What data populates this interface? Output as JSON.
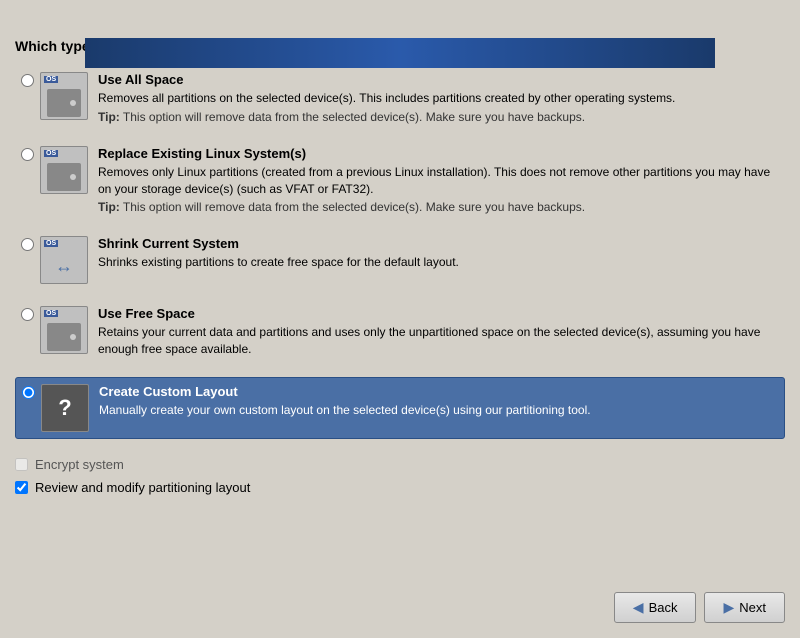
{
  "topBar": {},
  "pageTitle": "Which type of installation would you like?",
  "options": [
    {
      "id": "use-all-space",
      "title": "Use All Space",
      "desc": "Removes all partitions on the selected device(s).  This includes partitions created by other operating systems.",
      "tip": "Tip: This option will remove data from the selected device(s).  Make sure you have backups.",
      "selected": false,
      "iconType": "hdd-os"
    },
    {
      "id": "replace-existing",
      "title": "Replace Existing Linux System(s)",
      "desc": "Removes only Linux partitions (created from a previous Linux installation).  This does not remove other partitions you may have on your storage device(s) (such as VFAT or FAT32).",
      "tip": "Tip: This option will remove data from the selected device(s).  Make sure you have backups.",
      "selected": false,
      "iconType": "hdd-os"
    },
    {
      "id": "shrink-current",
      "title": "Shrink Current System",
      "desc": "Shrinks existing partitions to create free space for the default layout.",
      "tip": "",
      "selected": false,
      "iconType": "shrink"
    },
    {
      "id": "use-free-space",
      "title": "Use Free Space",
      "desc": "Retains your current data and partitions and uses only the unpartitioned space on the selected device(s), assuming you have enough free space available.",
      "tip": "",
      "selected": false,
      "iconType": "hdd-os"
    },
    {
      "id": "create-custom",
      "title": "Create Custom Layout",
      "desc": "Manually create your own custom layout on the selected device(s) using our partitioning tool.",
      "tip": "",
      "selected": true,
      "iconType": "question"
    }
  ],
  "checkboxes": [
    {
      "id": "encrypt-system",
      "label": "Encrypt system",
      "checked": false,
      "enabled": false
    },
    {
      "id": "review-partitioning",
      "label": "Review and modify partitioning layout",
      "checked": true,
      "enabled": true
    }
  ],
  "buttons": {
    "back": "Back",
    "next": "Next"
  }
}
